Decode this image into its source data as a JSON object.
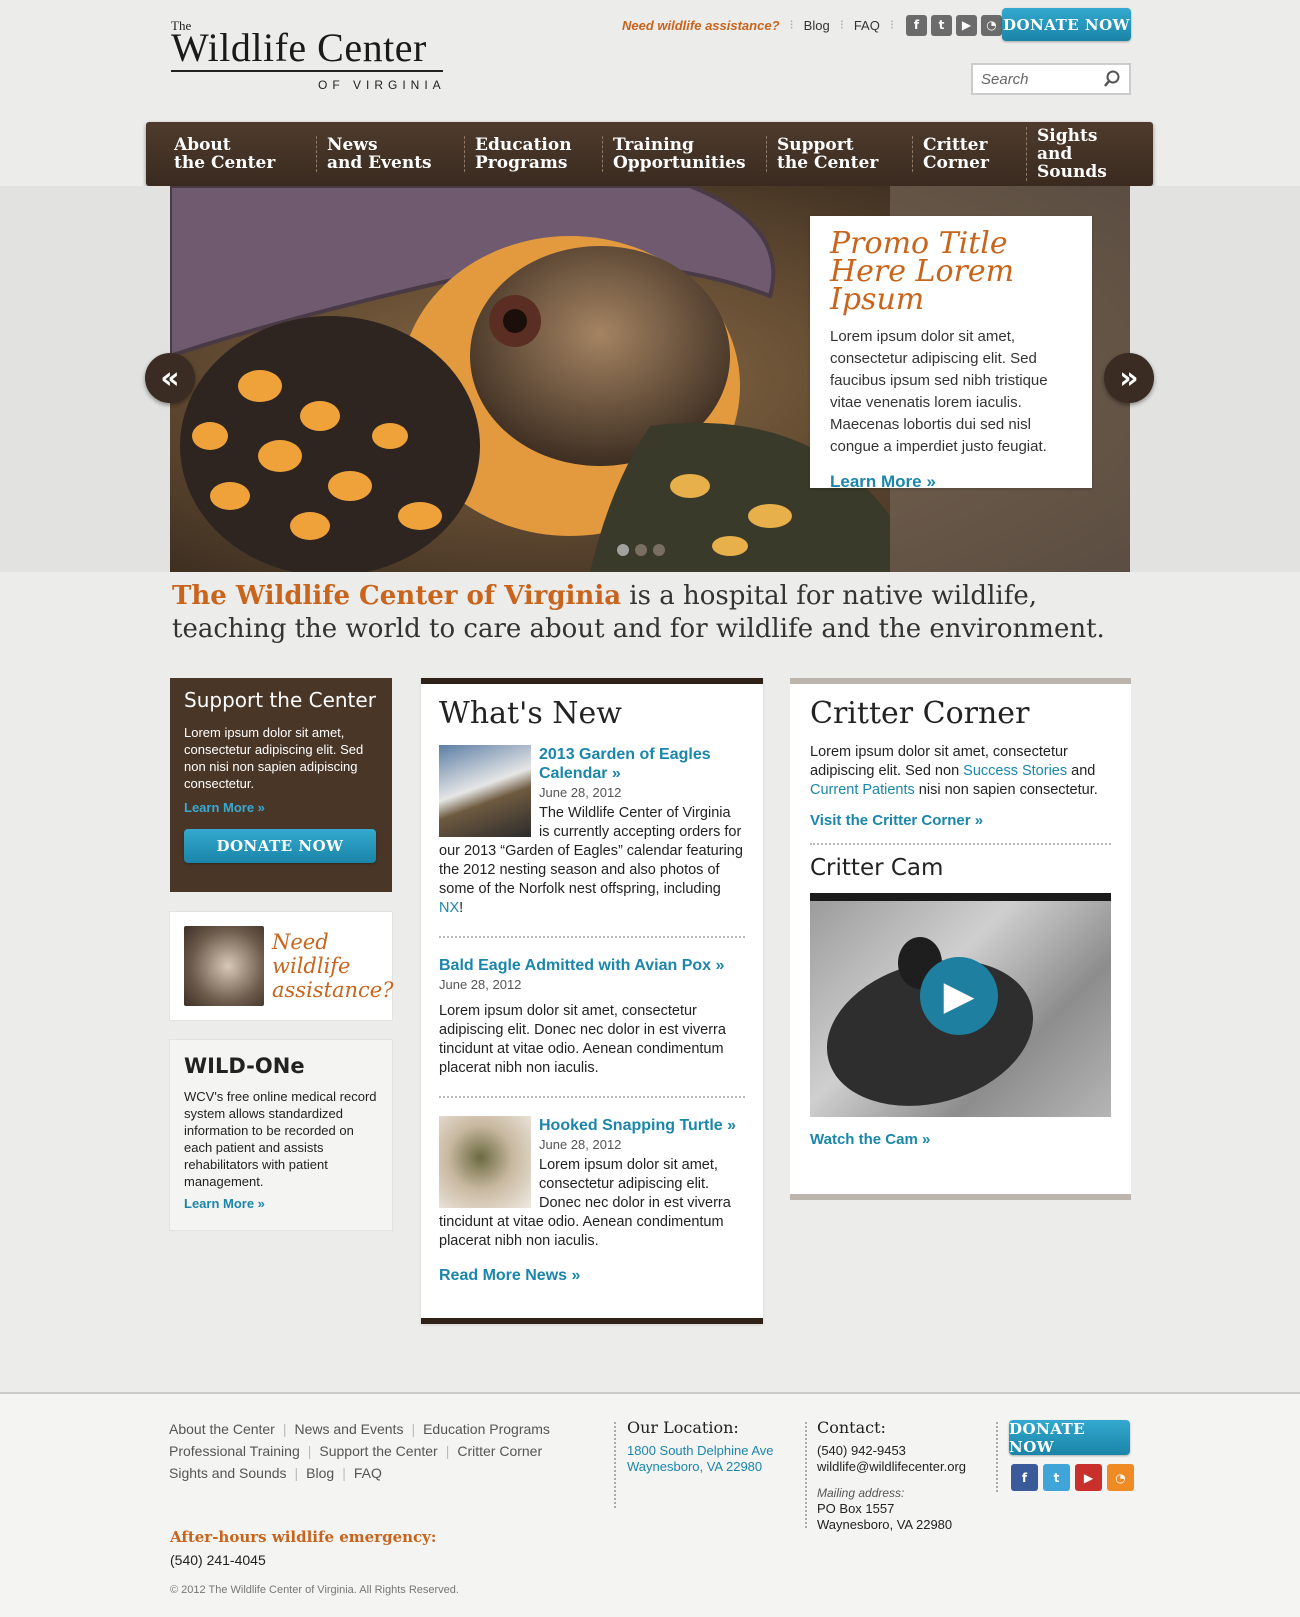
{
  "logo": {
    "the": "The",
    "main": "Wildlife Center",
    "sub": "OF VIRGINIA"
  },
  "toplinks": {
    "assist": "Need wildlife assistance?",
    "blog": "Blog",
    "faq": "FAQ"
  },
  "social": [
    {
      "icon": "facebook-icon",
      "glyph": "f"
    },
    {
      "icon": "twitter-icon",
      "glyph": "t"
    },
    {
      "icon": "youtube-icon",
      "glyph": "▶"
    },
    {
      "icon": "rss-icon",
      "glyph": "◔"
    }
  ],
  "donate_label": "DONATE NOW",
  "search": {
    "placeholder": "Search"
  },
  "nav": [
    "About\nthe Center",
    "News\nand Events",
    "Education\nPrograms",
    "Training\nOpportunities",
    "Support\nthe Center",
    "Critter\nCorner",
    "Sights\nand Sounds"
  ],
  "hero": {
    "prev": "«",
    "next": "»",
    "promo_title": "Promo Title Here Lorem Ipsum",
    "promo_text": "Lorem ipsum dolor sit amet, consectetur adipiscing elit. Sed faucibus ipsum sed nibh tristique vitae venenatis lorem iaculis. Maecenas lobortis dui sed nisl congue a imperdiet justo feugiat.",
    "promo_link": "Learn More »",
    "slides": 3,
    "active_slide": 1
  },
  "tagline": {
    "bold": "The Wildlife Center of Virginia",
    "rest": " is a hospital for native wildlife, teaching the world to care about and for wildlife and the environment."
  },
  "support": {
    "title": "Support the Center",
    "text": "Lorem ipsum dolor sit amet, consectetur adipiscing elit. Sed non nisi non sapien adipiscing consectetur.",
    "link": "Learn More »"
  },
  "assist_box": {
    "text": "Need wildlife assistance?"
  },
  "wildone": {
    "title": "WILD-ONe",
    "text": "WCV's free online medical record system allows standardized information to be recorded on each patient and assists rehabilitators with patient management.",
    "link": "Learn More »"
  },
  "news": {
    "title": "What's New",
    "items": [
      {
        "title": "2013 Garden of Eagles Calendar »",
        "date": "June 28, 2012",
        "text": "The Wildlife Center of Virginia is currently accepting orders for our 2013 “Garden of Eagles” calendar featuring the 2012 nesting season and also photos of some of the Norfolk nest offspring, including ",
        "link": "NX",
        "tail": "!"
      },
      {
        "title": "Bald Eagle Admitted with Avian Pox »",
        "date": "June 28, 2012",
        "text": "Lorem ipsum dolor sit amet, consectetur adipiscing elit. Donec nec dolor in est viverra tincidunt at vitae odio. Aenean condimentum placerat nibh non iaculis."
      },
      {
        "title": "Hooked Snapping Turtle »",
        "date": "June 28, 2012",
        "text": "Lorem ipsum dolor sit amet, consectetur adipiscing elit. Donec nec dolor in est viverra tincidunt at vitae odio. Aenean condimentum placerat nibh non iaculis."
      }
    ],
    "readmore": "Read More News »"
  },
  "critter": {
    "title": "Critter Corner",
    "text1": "Lorem ipsum dolor sit amet, consectetur adipiscing elit. Sed non ",
    "link1": "Success Stories",
    "text2": " and ",
    "link2": "Current Patients",
    "text3": " nisi non sapien consectetur.",
    "visit": "Visit the Critter Corner »",
    "cam_title": "Critter Cam",
    "watch": "Watch the Cam »"
  },
  "footer": {
    "links": [
      [
        "About the Center",
        "News and Events",
        "Education Programs"
      ],
      [
        "Professional Training",
        "Support the Center",
        "Critter Corner"
      ],
      [
        "Sights and Sounds",
        "Blog",
        "FAQ"
      ]
    ],
    "location_title": "Our Location:",
    "address1": "1800 South Delphine Ave",
    "address2": "Waynesboro, VA 22980",
    "contact_title": "Contact:",
    "phone": "(540) 942-9453",
    "email": "wildlife@wildlifecenter.org",
    "mailing_label": "Mailing address:",
    "po": "PO Box 1557",
    "city": "Waynesboro, VA 22980",
    "emergency_label": "After-hours wildlife emergency:",
    "emergency_phone": "(540) 241-4045",
    "copyright": "© 2012 The Wildlife Center of Virginia. All Rights Reserved."
  }
}
